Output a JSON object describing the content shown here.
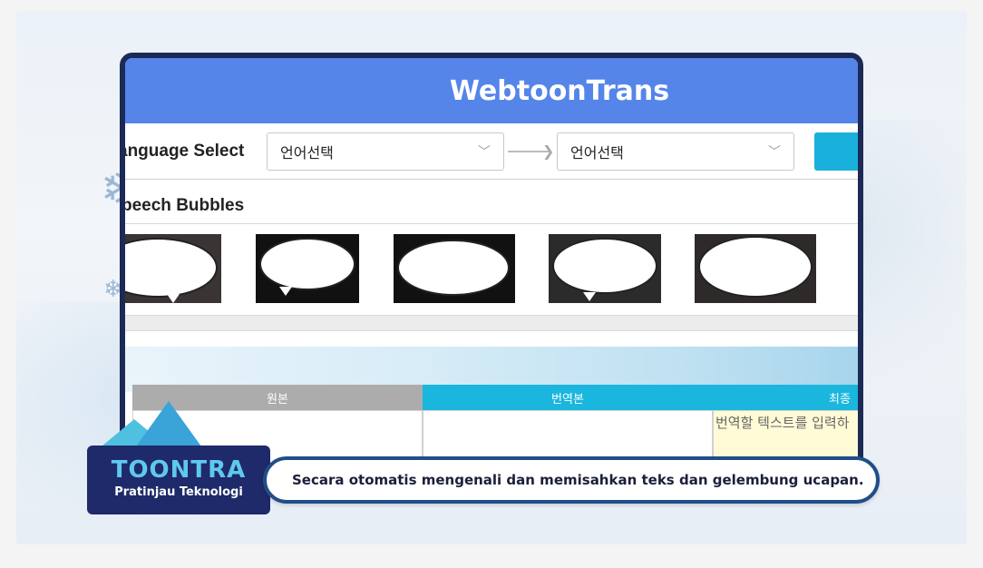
{
  "app": {
    "title": "WebtoonTrans"
  },
  "language_select": {
    "label": "anguage Select",
    "source_value": "언어선택",
    "target_value": "언어선택"
  },
  "speech_bubbles": {
    "label": "peech Bubbles",
    "count_visible": 5
  },
  "table": {
    "headers": [
      "원본",
      "번역본",
      "최종"
    ],
    "final_placeholder": "번역할 텍스트를 입력하"
  },
  "overlay": {
    "brand": "TOONTRA",
    "brand_sub": "Pratinjau Teknologi",
    "caption": "Secara otomatis mengenali dan memisahkan teks dan gelembung ucapan."
  },
  "colors": {
    "header_blue": "#5585e9",
    "accent_cyan": "#1ab6de",
    "brand_navy": "#1f2a6a"
  }
}
